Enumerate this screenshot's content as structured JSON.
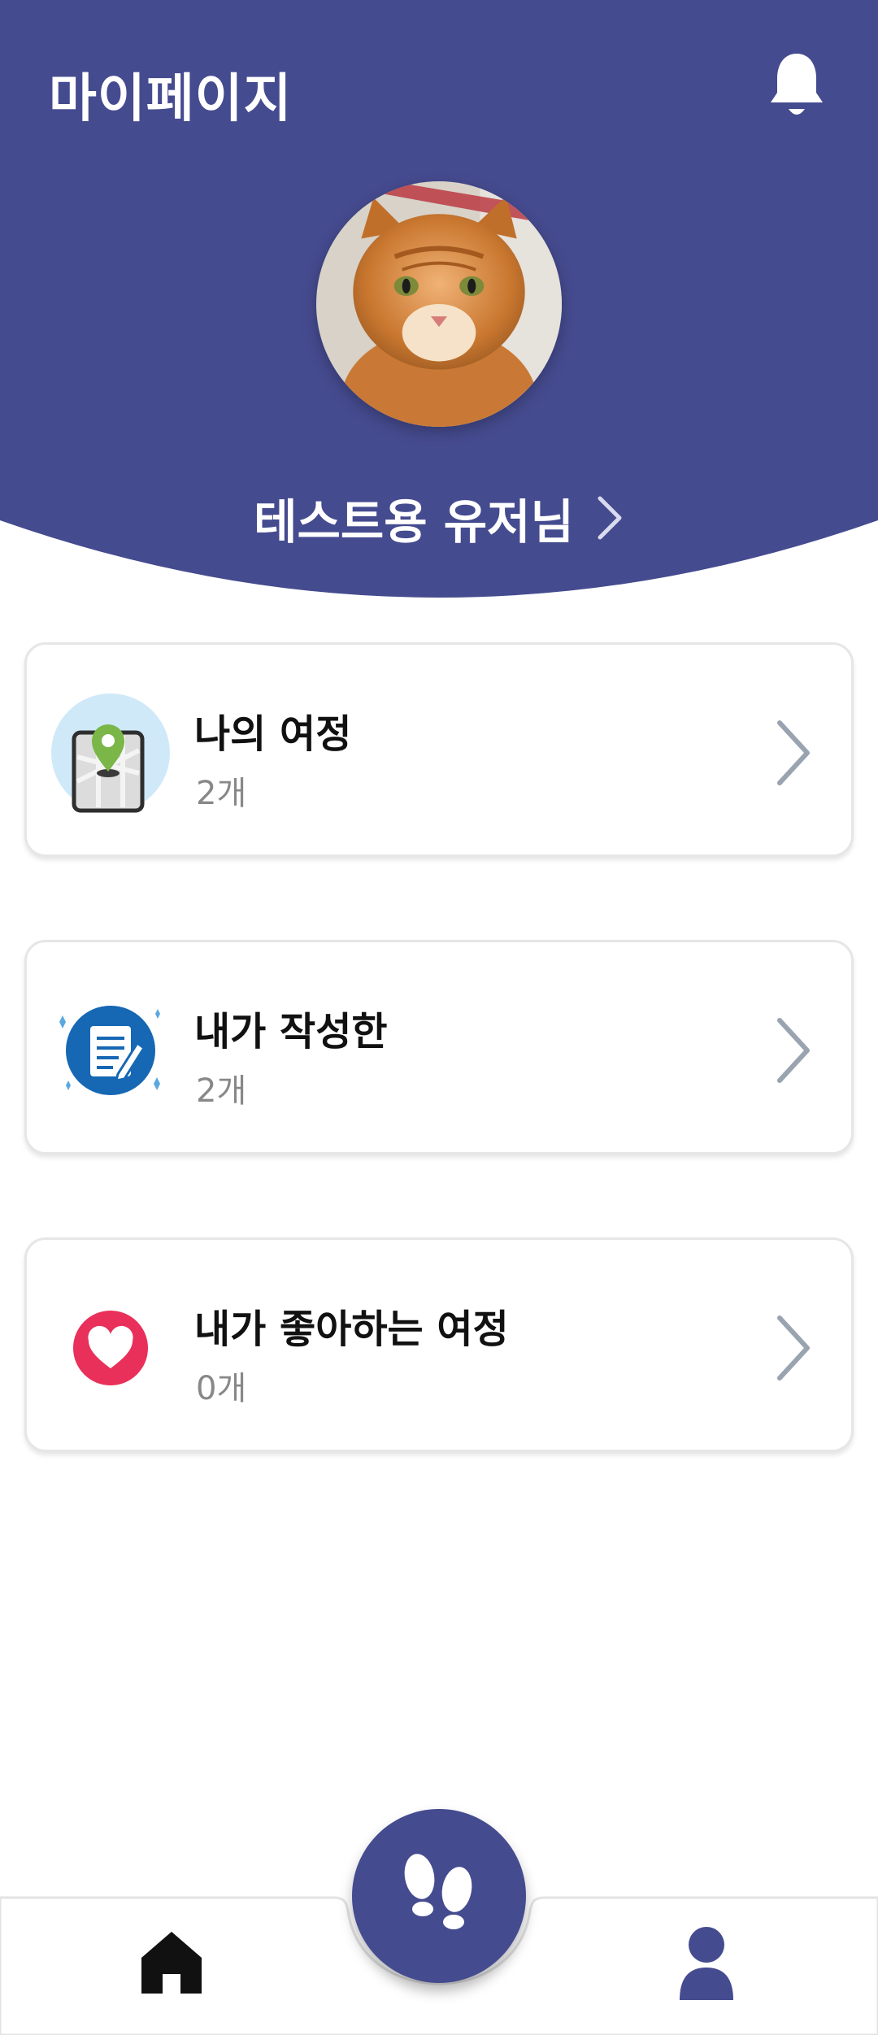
{
  "colors": {
    "header_bg": "#454B8F",
    "card_border": "#e6e6e6",
    "count_text": "#888888",
    "chevron": "#9aa3b0",
    "heart": "#e8305a",
    "fab_bg": "#454B8F"
  },
  "header": {
    "title": "마이페이지",
    "notification_icon": "bell-icon",
    "username": "테스트용 유저님",
    "username_icon": "chevron-right-icon"
  },
  "cards": [
    {
      "title": "나의 여정",
      "count": "2개",
      "icon": "map-pin-icon"
    },
    {
      "title": "내가 작성한",
      "count": "2개",
      "icon": "document-edit-icon"
    },
    {
      "title": "내가 좋아하는 여정",
      "count": "0개",
      "icon": "heart-icon"
    }
  ],
  "bottom_nav": {
    "left_icon": "home-icon",
    "center_icon": "footprints-icon",
    "right_icon": "profile-icon"
  }
}
